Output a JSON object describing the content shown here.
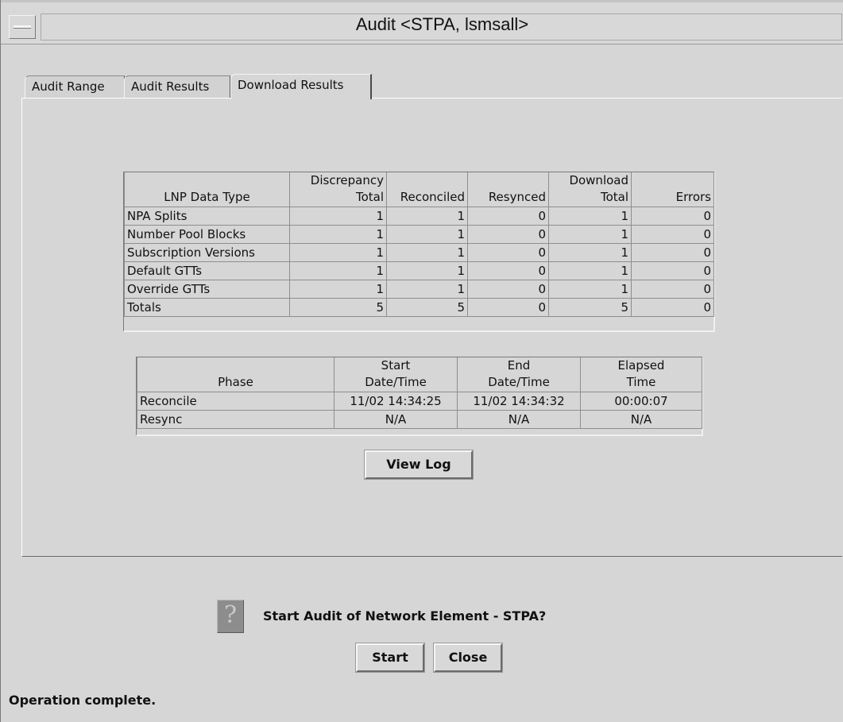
{
  "window": {
    "title": "Audit <STPA, lsmsall>"
  },
  "tabs": [
    {
      "label": "Audit Range"
    },
    {
      "label": "Audit Results"
    },
    {
      "label": "Download Results"
    }
  ],
  "active_tab": "Download Results",
  "results_table": {
    "headers": [
      [
        "",
        "LNP Data Type"
      ],
      [
        "Discrepancy",
        "Total"
      ],
      [
        "",
        "Reconciled"
      ],
      [
        "",
        "Resynced"
      ],
      [
        "Download",
        "Total"
      ],
      [
        "",
        "Errors"
      ]
    ],
    "rows": [
      [
        "NPA Splits",
        "1",
        "1",
        "0",
        "1",
        "0"
      ],
      [
        "Number Pool Blocks",
        "1",
        "1",
        "0",
        "1",
        "0"
      ],
      [
        "Subscription Versions",
        "1",
        "1",
        "0",
        "1",
        "0"
      ],
      [
        "Default GTTs",
        "1",
        "1",
        "0",
        "1",
        "0"
      ],
      [
        "Override GTTs",
        "1",
        "1",
        "0",
        "1",
        "0"
      ],
      [
        "Totals",
        "5",
        "5",
        "0",
        "5",
        "0"
      ]
    ]
  },
  "phase_table": {
    "headers": [
      [
        "",
        "Phase"
      ],
      [
        "Start",
        "Date/Time"
      ],
      [
        "End",
        "Date/Time"
      ],
      [
        "Elapsed",
        "Time"
      ]
    ],
    "rows": [
      [
        "Reconcile",
        "11/02 14:34:25",
        "11/02 14:34:32",
        "00:00:07"
      ],
      [
        "Resync",
        "N/A",
        "N/A",
        "N/A"
      ]
    ]
  },
  "buttons": {
    "view_log": "View Log",
    "start": "Start",
    "close": "Close"
  },
  "prompt": {
    "icon": "question-icon",
    "text": "Start Audit of Network Element - STPA?"
  },
  "status": "Operation complete.",
  "colors": {
    "background": "#d6d6d6",
    "icon_bg": "#8d8d8d"
  }
}
